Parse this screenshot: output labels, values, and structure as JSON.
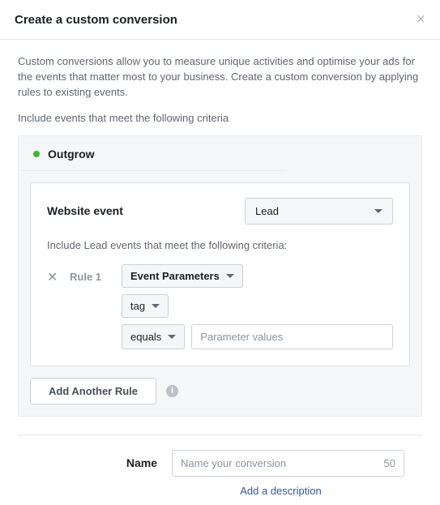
{
  "header": {
    "title": "Create a custom conversion"
  },
  "intro": "Custom conversions allow you to measure unique activities and optimise your ads for the events that matter most to your business. Create a custom conversion by applying rules to existing events.",
  "criteria_label": "Include events that meet the following criteria",
  "pixel": {
    "name": "Outgrow"
  },
  "event": {
    "label": "Website event",
    "selected": "Lead",
    "criteria_text": "Include Lead events that meet the following criteria:"
  },
  "rule": {
    "label": "Rule 1",
    "param_type": "Event Parameters",
    "tag": "tag",
    "operator": "equals",
    "value_placeholder": "Parameter values"
  },
  "add_rule_label": "Add Another Rule",
  "name_section": {
    "label": "Name",
    "placeholder": "Name your conversion",
    "char_limit": "50",
    "add_description": "Add a description"
  }
}
